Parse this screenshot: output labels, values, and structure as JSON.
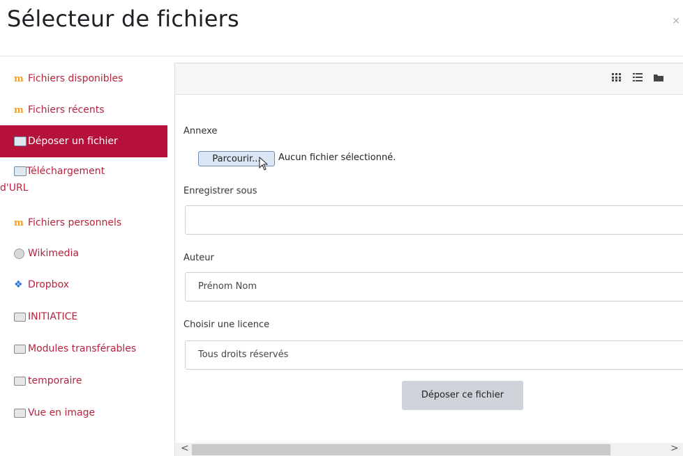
{
  "dialog": {
    "title": "Sélecteur de fichiers",
    "close_glyph": "×"
  },
  "sidebar": {
    "items": [
      {
        "label": "Fichiers disponibles",
        "icon": "moodle-icon"
      },
      {
        "label": "Fichiers récents",
        "icon": "moodle-icon"
      },
      {
        "label": "Déposer un fichier",
        "icon": "upload-icon",
        "active": true
      },
      {
        "label": "Téléchargement d'URL",
        "line1": "Téléchargement",
        "line2": "d'URL",
        "icon": "url-download-icon"
      },
      {
        "label": "Fichiers personnels",
        "icon": "moodle-icon"
      },
      {
        "label": "Wikimedia",
        "icon": "wikimedia-icon"
      },
      {
        "label": "Dropbox",
        "icon": "dropbox-icon"
      },
      {
        "label": "INITIATICE",
        "icon": "folder-icon"
      },
      {
        "label": "Modules transférables",
        "icon": "folder-icon"
      },
      {
        "label": "temporaire",
        "icon": "folder-icon"
      },
      {
        "label": "Vue en image",
        "icon": "folder-icon"
      }
    ],
    "active_color": "#b5113a",
    "link_color": "#b5243f"
  },
  "toolbar": {
    "views": [
      "grid-view-icon",
      "list-view-icon",
      "folder-view-icon"
    ]
  },
  "form": {
    "attachment_label": "Annexe",
    "browse_label": "Parcourir...",
    "no_file_text": "Aucun fichier sélectionné.",
    "save_as_label": "Enregistrer sous",
    "save_as_value": "",
    "author_label": "Auteur",
    "author_value": "Prénom Nom",
    "license_label": "Choisir une licence",
    "license_value": "Tous droits réservés",
    "submit_label": "Déposer ce fichier"
  },
  "scrollbar": {
    "left_arrow": "<",
    "right_arrow": ">"
  }
}
